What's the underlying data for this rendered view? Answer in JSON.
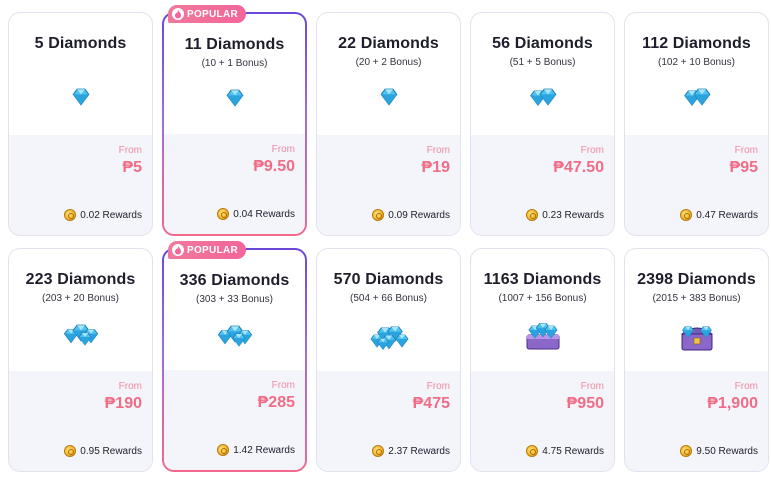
{
  "badge_label": "POPULAR",
  "from_label": "From",
  "colors": {
    "price": "#ef6d86",
    "popular_border_start": "#6b48d6",
    "popular_border_end": "#f06a8c",
    "card_bottom_bg": "#f4f4fb"
  },
  "packages": [
    {
      "title": "5 Diamonds",
      "bonus": "",
      "price": "₱5",
      "rewards": "0.02 Rewards",
      "popular": false,
      "icon": "diamond-small-icon"
    },
    {
      "title": "11 Diamonds",
      "bonus": "(10 + 1 Bonus)",
      "price": "₱9.50",
      "rewards": "0.04 Rewards",
      "popular": true,
      "icon": "diamond-small-icon"
    },
    {
      "title": "22 Diamonds",
      "bonus": "(20 + 2 Bonus)",
      "price": "₱19",
      "rewards": "0.09 Rewards",
      "popular": false,
      "icon": "diamond-small-icon"
    },
    {
      "title": "56 Diamonds",
      "bonus": "(51 + 5 Bonus)",
      "price": "₱47.50",
      "rewards": "0.23 Rewards",
      "popular": false,
      "icon": "diamond-pair-icon"
    },
    {
      "title": "112 Diamonds",
      "bonus": "(102 + 10 Bonus)",
      "price": "₱95",
      "rewards": "0.47 Rewards",
      "popular": false,
      "icon": "diamond-pair-icon"
    },
    {
      "title": "223 Diamonds",
      "bonus": "(203 + 20 Bonus)",
      "price": "₱190",
      "rewards": "0.95 Rewards",
      "popular": false,
      "icon": "diamond-cluster-icon"
    },
    {
      "title": "336 Diamonds",
      "bonus": "(303 + 33 Bonus)",
      "price": "₱285",
      "rewards": "1.42 Rewards",
      "popular": true,
      "icon": "diamond-cluster-icon"
    },
    {
      "title": "570 Diamonds",
      "bonus": "(504 + 66 Bonus)",
      "price": "₱475",
      "rewards": "2.37 Rewards",
      "popular": false,
      "icon": "diamond-pile-icon"
    },
    {
      "title": "1163 Diamonds",
      "bonus": "(1007 + 156 Bonus)",
      "price": "₱950",
      "rewards": "4.75 Rewards",
      "popular": false,
      "icon": "diamond-crate-icon"
    },
    {
      "title": "2398 Diamonds",
      "bonus": "(2015 + 383 Bonus)",
      "price": "₱1,900",
      "rewards": "9.50 Rewards",
      "popular": false,
      "icon": "diamond-chest-icon"
    }
  ]
}
